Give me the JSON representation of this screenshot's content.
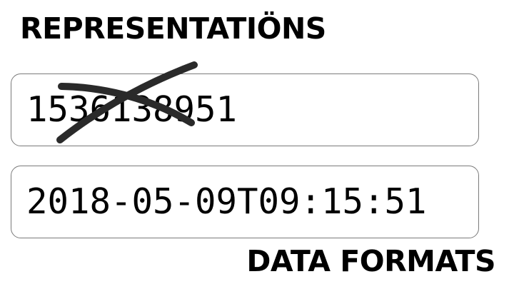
{
  "heading": "REPRESENTATIÖNS",
  "fields": [
    {
      "value": "1536138951",
      "struck_out": true
    },
    {
      "value": "2018-05-09T09:15:51",
      "struck_out": false
    }
  ],
  "footer_label": "DATA FORMATS",
  "colors": {
    "text": "#000000",
    "border": "#7a7a7a",
    "background": "#ffffff",
    "strike": "#2a2a2a"
  }
}
